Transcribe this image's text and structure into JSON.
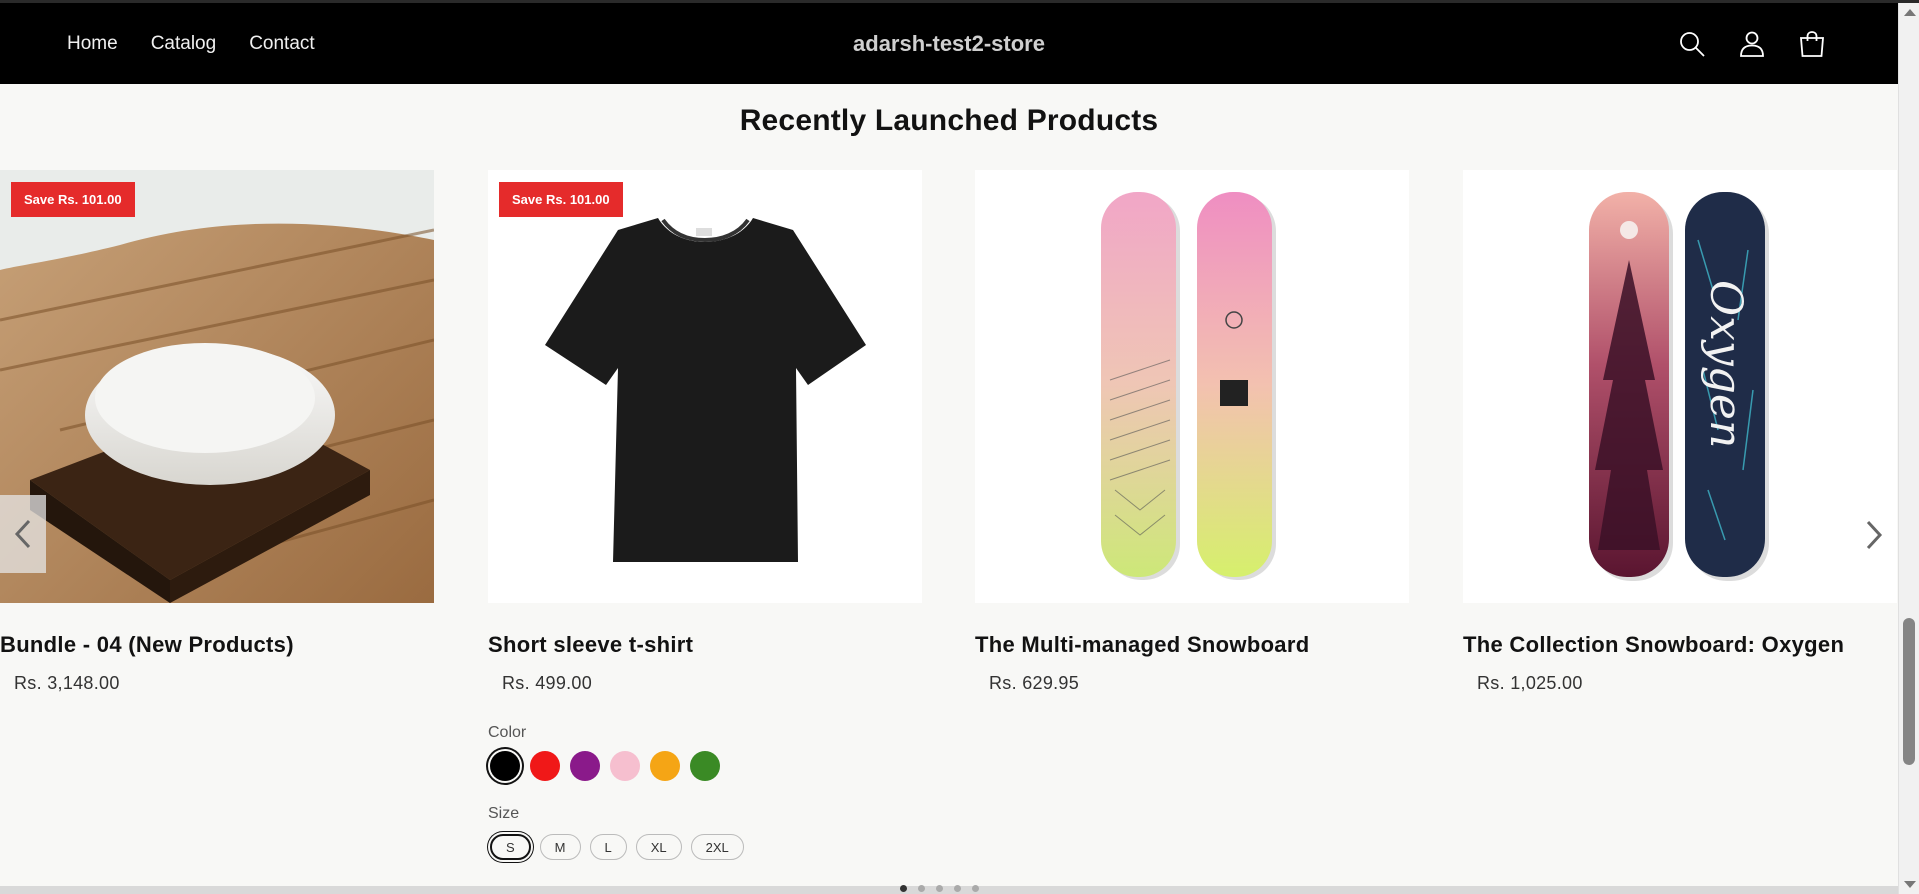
{
  "header": {
    "nav": [
      "Home",
      "Catalog",
      "Contact"
    ],
    "brand": "adarsh-test2-store",
    "icons": [
      "search-icon",
      "account-icon",
      "cart-icon"
    ]
  },
  "section": {
    "title": "Recently Launched Products"
  },
  "products": [
    {
      "title": "Bundle - 04 (New Products)",
      "price": "Rs. 3,148.00",
      "badge": "Save Rs. 101.00",
      "image": "soap-bar-on-wooden-dish"
    },
    {
      "title": "Short sleeve t-shirt",
      "price": "Rs. 499.00",
      "badge": "Save Rs. 101.00",
      "image": "black-t-shirt"
    },
    {
      "title": "The Multi-managed Snowboard",
      "price": "Rs. 629.95",
      "badge": "",
      "image": "pink-yellow-snowboards"
    },
    {
      "title": "The Collection Snowboard: Oxygen",
      "price": "Rs. 1,025.00",
      "badge": "",
      "image": "oxygen-snowboards"
    }
  ],
  "variant_options": {
    "color_label": "Color",
    "colors": [
      "#000000",
      "#f01818",
      "#8a1a8a",
      "#f6bfcf",
      "#f5a515",
      "#3a8a25"
    ],
    "selected_color": "#000000",
    "size_label": "Size",
    "sizes": [
      "S",
      "M",
      "L",
      "XL",
      "2XL"
    ],
    "selected_size": "S"
  },
  "slider": {
    "dots": 5,
    "active_dot": 0
  },
  "colors": {
    "header_bg": "#000000",
    "badge_bg": "#e52b2b",
    "page_bg": "#f8f8f6"
  }
}
